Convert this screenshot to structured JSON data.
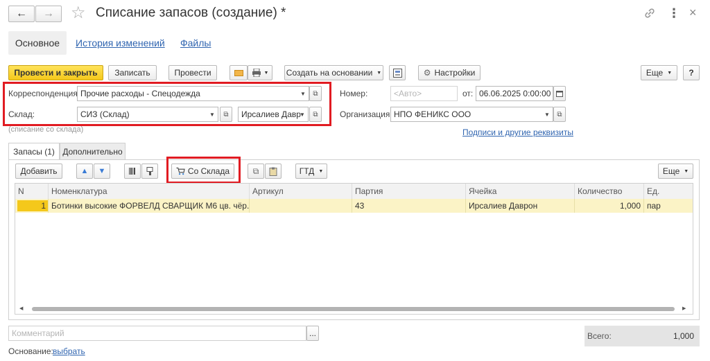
{
  "window": {
    "title": "Списание запасов (создание) *",
    "nav_back": "←",
    "nav_forward": "→",
    "star": "☆",
    "link_icon": "🔗",
    "more_icon": "⋮",
    "close_icon": "×"
  },
  "tabs": {
    "main": "Основное",
    "history": "История изменений",
    "files": "Файлы"
  },
  "toolbar": {
    "post_close": "Провести и закрыть",
    "save": "Записать",
    "post": "Провести",
    "create_based": "Создать на основании",
    "settings": "Настройки",
    "more": "Еще",
    "help": "?"
  },
  "form": {
    "corr_label": "Корреспонденция:",
    "corr_value": "Прочие расходы - Спецодежда",
    "warehouse_label": "Склад:",
    "warehouse_value": "СИЗ (Склад)",
    "person_value": "Ирсалиев Давр",
    "number_label": "Номер:",
    "number_placeholder": "<Авто>",
    "date_label": "от:",
    "date_value": "06.06.2025  0:00:00",
    "org_label": "Организация:",
    "org_value": "НПО ФЕНИКС ООО",
    "write_off_note": "(списание со склада)",
    "signatures_link": "Подписи и другие реквизиты"
  },
  "inner_tabs": {
    "stocks": "Запасы (1)",
    "additional": "Дополнительно"
  },
  "table_toolbar": {
    "add": "Добавить",
    "from_warehouse": "Со Склада",
    "gtd": "ГТД",
    "more": "Еще"
  },
  "table": {
    "columns": [
      "N",
      "Номенклатура",
      "Артикул",
      "Партия",
      "Ячейка",
      "Количество",
      "Ед."
    ],
    "rows": [
      [
        "1",
        "Ботинки высокие ФОРВЕЛД СВАРЩИК М6 цв. чёр...",
        "",
        "43",
        "Ирсалиев Даврон",
        "1,000",
        "пар"
      ]
    ]
  },
  "footer": {
    "comment_placeholder": "Комментарий",
    "comment_btn": "...",
    "total_label": "Всего:",
    "total_value": "1,000",
    "basis_label": "Основание:",
    "basis_link": "выбрать"
  },
  "colors": {
    "accent_yellow": "#f4c81b",
    "highlight_red": "#e11b22",
    "selected_row": "#fbf3c6",
    "link_blue": "#3065b0"
  }
}
